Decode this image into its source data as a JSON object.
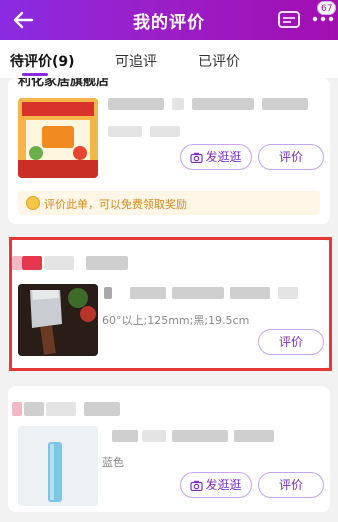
{
  "header": {
    "title": "我的评价",
    "message_badge": "67",
    "colors": {
      "gradient_start": "#8a2be2",
      "gradient_end": "#a10fb0"
    }
  },
  "tabs": [
    {
      "label": "待评价(9)",
      "active": true
    },
    {
      "label": "可追评",
      "active": false
    },
    {
      "label": "已评价",
      "active": false
    }
  ],
  "orders": [
    {
      "shop_name": "利化家居旗舰店",
      "actions": [
        {
          "label": "发逛逛",
          "icon": "camera-icon"
        },
        {
          "label": "评价"
        }
      ],
      "reward_text": "评价此单，可以免费领取奖励"
    },
    {
      "spec": "60°以上;125mm;黑;19.5cm",
      "actions": [
        {
          "label": "评价"
        }
      ]
    },
    {
      "spec": "蓝色",
      "actions": [
        {
          "label": "发逛逛",
          "icon": "camera-icon"
        },
        {
          "label": "评价"
        }
      ]
    }
  ],
  "accent_color": "#8a2be2",
  "highlight_color": "#e53935"
}
